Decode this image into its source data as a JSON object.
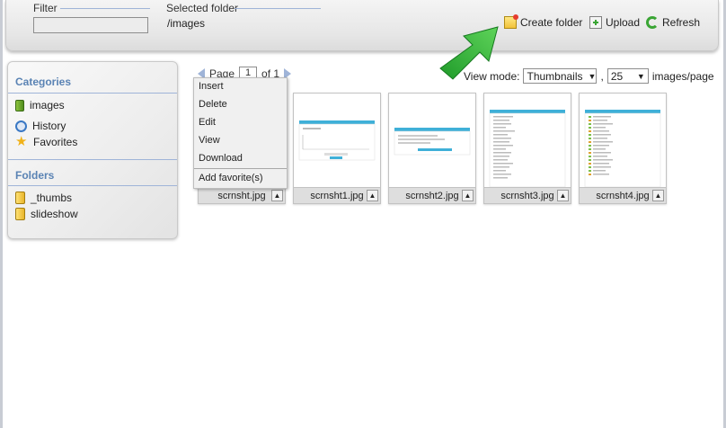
{
  "toolbar": {
    "filter_label": "Filter",
    "filter_value": "",
    "selected_folder_label": "Selected folder",
    "selected_folder_path": "/images",
    "create_folder_label": "Create folder",
    "upload_label": "Upload",
    "refresh_label": "Refresh"
  },
  "sidebar": {
    "categories_title": "Categories",
    "categories": [
      {
        "label": "images",
        "icon": "category-icon"
      },
      {
        "label": "History",
        "icon": "history-icon"
      },
      {
        "label": "Favorites",
        "icon": "star-icon"
      }
    ],
    "folders_title": "Folders",
    "folders": [
      {
        "label": "_thumbs",
        "icon": "folder-icon"
      },
      {
        "label": "slideshow",
        "icon": "folder-icon"
      }
    ]
  },
  "pager": {
    "page_label": "Page",
    "page_value": "1",
    "of_label": "of 1"
  },
  "view": {
    "mode_label": "View mode:",
    "mode_value": "Thumbnails",
    "comma": ",",
    "per_page_value": "25",
    "per_page_label": "images/page"
  },
  "thumbnails": [
    {
      "caption": "scrnsht.jpg"
    },
    {
      "caption": "scrnsht1.jpg"
    },
    {
      "caption": "scrnsht2.jpg"
    },
    {
      "caption": "scrnsht3.jpg"
    },
    {
      "caption": "scrnsht4.jpg"
    }
  ],
  "context_menu": {
    "items": [
      "Insert",
      "Delete",
      "Edit",
      "View",
      "Download"
    ],
    "extra_item": "Add favorite(s)"
  },
  "colors": {
    "accent": "#5a83b4",
    "arrow": "#2fb534"
  }
}
